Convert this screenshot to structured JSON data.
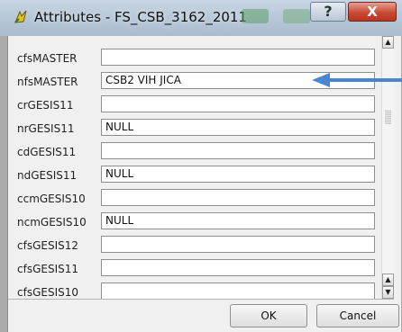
{
  "window": {
    "title": "Attributes - FS_CSB_3162_2011",
    "help_label": "?",
    "close_label": "X"
  },
  "fields": [
    {
      "name": "cfsMASTER",
      "value": ""
    },
    {
      "name": "nfsMASTER",
      "value": "CSB2 VIH JICA"
    },
    {
      "name": "crGESIS11",
      "value": ""
    },
    {
      "name": "nrGESIS11",
      "value": "NULL"
    },
    {
      "name": "cdGESIS11",
      "value": ""
    },
    {
      "name": "ndGESIS11",
      "value": "NULL"
    },
    {
      "name": "ccmGESIS10",
      "value": ""
    },
    {
      "name": "ncmGESIS10",
      "value": "NULL"
    },
    {
      "name": "cfsGESIS12",
      "value": ""
    },
    {
      "name": "cfsGESIS11",
      "value": ""
    },
    {
      "name": "cfsGESIS10",
      "value": ""
    }
  ],
  "buttons": {
    "ok": "OK",
    "cancel": "Cancel"
  },
  "scroll": {
    "up": "▲",
    "down": "▼"
  },
  "colors": {
    "arrow": "#4a86cf"
  }
}
